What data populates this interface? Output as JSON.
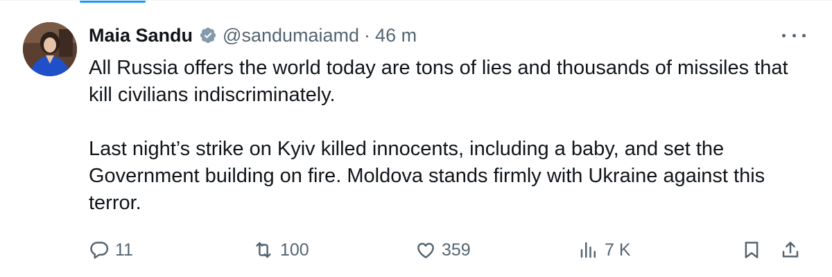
{
  "author": {
    "name": "Maia Sandu",
    "handle": "@sandumaiamd",
    "separator": "·",
    "time": "46 m",
    "verified": true,
    "verified_color": "#829aab"
  },
  "tweet": {
    "paragraph_1": "All Russia offers the world today are tons of lies and thousands of missiles that kill civilians indiscriminately.",
    "paragraph_2": "Last night’s strike on Kyiv killed innocents, including a baby, and set the Government building on fire. Moldova stands firmly with Ukraine against this terror."
  },
  "actions": {
    "replies": "11",
    "reposts": "100",
    "likes": "359",
    "views": "7 K"
  },
  "icons": {
    "more": "more-options-icon",
    "reply": "reply-icon",
    "repost": "repost-icon",
    "like": "heart-icon",
    "views": "views-icon",
    "bookmark": "bookmark-icon",
    "share": "share-icon"
  },
  "colors": {
    "accent": "#1d9bf0",
    "text": "#0f1419",
    "muted": "#536471"
  }
}
